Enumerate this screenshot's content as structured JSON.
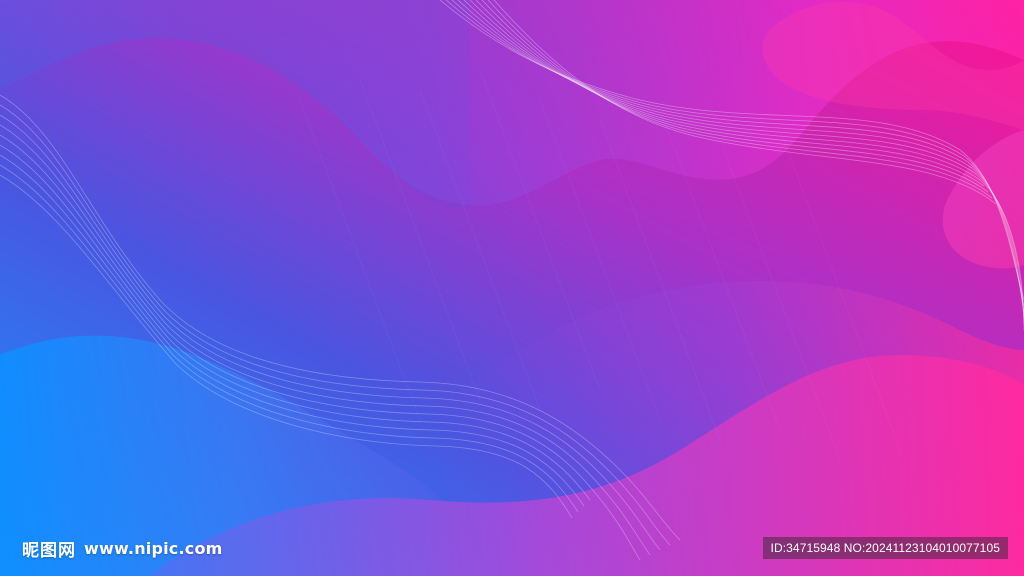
{
  "colors": {
    "blue": "#1a8cff",
    "indigo": "#4a4fd9",
    "purple": "#9a3ad0",
    "magenta": "#e020a8",
    "hot_pink": "#ff1a90"
  },
  "watermark": {
    "logo_chinese": "昵图网",
    "logo_url": "www.nipic.com",
    "id_text": "ID:34715948 NO:20241123104010077105"
  }
}
